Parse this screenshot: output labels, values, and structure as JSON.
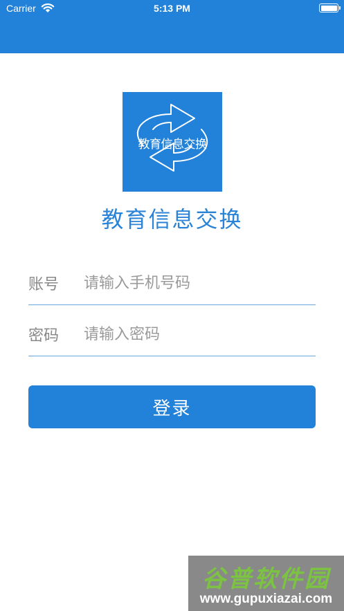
{
  "status_bar": {
    "carrier": "Carrier",
    "time": "5:13 PM",
    "icons": [
      "wifi-icon",
      "battery-icon"
    ]
  },
  "logo": {
    "text": "教育信息交换",
    "icon": "exchange-arrows-icon"
  },
  "app_title": "教育信息交换",
  "form": {
    "account": {
      "label": "账号",
      "value": "",
      "placeholder": "请输入手机号码"
    },
    "password": {
      "label": "密码",
      "value": "",
      "placeholder": "请输入密码"
    },
    "login_label": "登录"
  },
  "watermark": {
    "title": "谷普软件园",
    "url": "www.gupuxiazai.com"
  },
  "colors": {
    "primary": "#2281d8",
    "title_text": "#2a83d6",
    "field_underline": "#6aa7e0",
    "label_text": "#888888"
  }
}
